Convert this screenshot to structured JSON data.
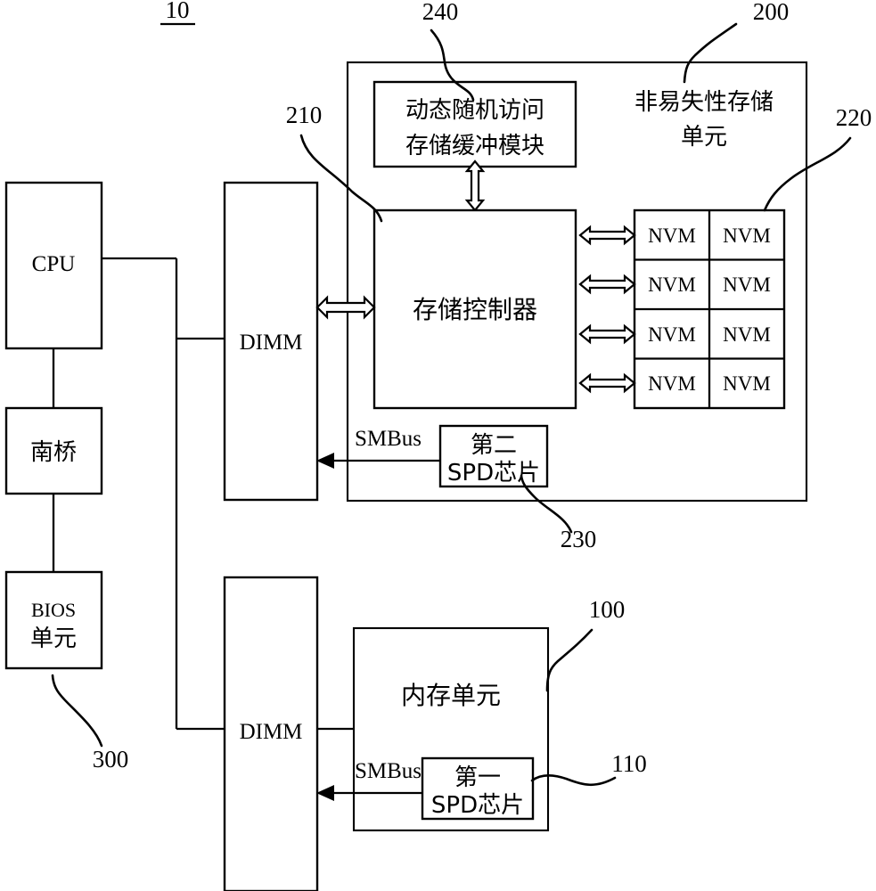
{
  "figure": {
    "number": "10",
    "underlined": true
  },
  "reference_labels": [
    {
      "id": "ref-240",
      "value": "240",
      "target": "dram-buffer-module"
    },
    {
      "id": "ref-200",
      "value": "200",
      "target": "nonvolatile-storage-unit"
    },
    {
      "id": "ref-210",
      "value": "210",
      "target": "memory-controller"
    },
    {
      "id": "ref-220",
      "value": "220",
      "target": "nvm-array"
    },
    {
      "id": "ref-230",
      "value": "230",
      "target": "second-spd-chip"
    },
    {
      "id": "ref-100",
      "value": "100",
      "target": "memory-unit"
    },
    {
      "id": "ref-110",
      "value": "110",
      "target": "first-spd-chip"
    },
    {
      "id": "ref-300",
      "value": "300",
      "target": "bios-unit"
    }
  ],
  "blocks": {
    "cpu": {
      "label": "CPU"
    },
    "southbridge": {
      "label": "南桥"
    },
    "bios_unit": {
      "line1": "BIOS",
      "line2": "单元"
    },
    "dimm_top": {
      "label": "DIMM"
    },
    "dimm_bottom": {
      "label": "DIMM"
    },
    "nonvolatile_unit": {
      "line1": "非易失性存储",
      "line2": "单元"
    },
    "dram_buffer": {
      "line1": "动态随机访问",
      "line2": "存储缓冲模块"
    },
    "memory_controller": {
      "label": "存储控制器"
    },
    "second_spd": {
      "line1": "第二",
      "line2": "SPD芯片"
    },
    "memory_unit": {
      "label": "内存单元"
    },
    "first_spd": {
      "line1": "第一",
      "line2": "SPD芯片"
    }
  },
  "nvm_array": {
    "cell_label": "NVM",
    "rows": 4,
    "cols": 2,
    "cells": [
      [
        "NVM",
        "NVM"
      ],
      [
        "NVM",
        "NVM"
      ],
      [
        "NVM",
        "NVM"
      ],
      [
        "NVM",
        "NVM"
      ]
    ]
  },
  "bus_labels": {
    "smbus_top": "SMBus",
    "smbus_bottom": "SMBus"
  },
  "colors": {
    "stroke": "#000000",
    "fill": "#ffffff"
  }
}
